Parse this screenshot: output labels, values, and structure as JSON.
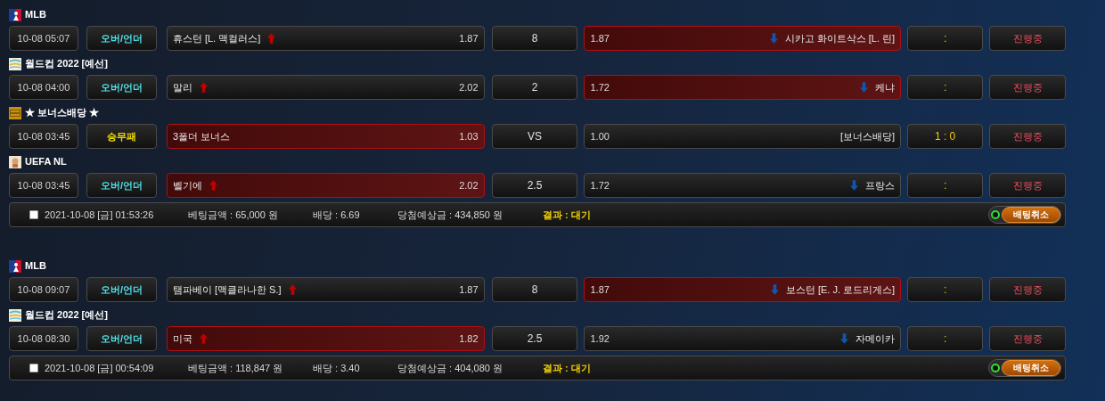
{
  "bets": [
    {
      "games": [
        {
          "league": {
            "name": "MLB",
            "kind": "mlb"
          },
          "time": "10-08 05:07",
          "market": {
            "label": "오버/언더",
            "kind": "over_under"
          },
          "home": {
            "name": "휴스턴 [L. 맥컬러스]",
            "odds": "1.87",
            "selected": false,
            "rising": true
          },
          "line": "8",
          "away": {
            "odds": "1.87",
            "name": "시카고 화이트삭스 [L. 린]",
            "selected": true,
            "falling": true
          },
          "score": ":",
          "status": "진행중"
        },
        {
          "league": {
            "name": "월드컵 2022 [예선]",
            "kind": "worldcup"
          },
          "time": "10-08 04:00",
          "market": {
            "label": "오버/언더",
            "kind": "over_under"
          },
          "home": {
            "name": "말리",
            "odds": "2.02",
            "selected": false,
            "rising": true
          },
          "line": "2",
          "away": {
            "odds": "1.72",
            "name": "케냐",
            "selected": true,
            "falling": true
          },
          "score": ":",
          "status": "진행중"
        },
        {
          "league": {
            "name": "★ 보너스배당 ★",
            "kind": "bonus"
          },
          "time": "10-08 03:45",
          "market": {
            "label": "승무패",
            "kind": "win_draw_lose"
          },
          "home": {
            "name": "3폴더 보너스",
            "odds": "1.03",
            "selected": true
          },
          "line": "VS",
          "away": {
            "odds": "1.00",
            "name": "[보너스배당]",
            "selected": false
          },
          "score": "1 : 0",
          "status": "진행중"
        },
        {
          "league": {
            "name": "UEFA NL",
            "kind": "uefa"
          },
          "time": "10-08 03:45",
          "market": {
            "label": "오버/언더",
            "kind": "over_under"
          },
          "home": {
            "name": "벨기에",
            "odds": "2.02",
            "selected": true,
            "rising": true
          },
          "line": "2.5",
          "away": {
            "odds": "1.72",
            "name": "프랑스",
            "selected": false,
            "falling": true
          },
          "score": ":",
          "status": "진행중"
        }
      ],
      "slip": {
        "checked": false,
        "date": "2021-10-08 [금] 01:53:26",
        "amount": "베팅금액 : 65,000 원",
        "odds": "배당 : 6.69",
        "payout": "당첨예상금 : 434,850 원",
        "result": "결과 : 대기",
        "cancel": "배팅취소"
      }
    },
    {
      "games": [
        {
          "league": {
            "name": "MLB",
            "kind": "mlb"
          },
          "time": "10-08 09:07",
          "market": {
            "label": "오버/언더",
            "kind": "over_under"
          },
          "home": {
            "name": "탬파베이 [맥클라나한 S.]",
            "odds": "1.87",
            "selected": false,
            "rising": true
          },
          "line": "8",
          "away": {
            "odds": "1.87",
            "name": "보스턴 [E. J. 로드리게스]",
            "selected": true,
            "falling": true
          },
          "score": ":",
          "status": "진행중"
        },
        {
          "league": {
            "name": "월드컵 2022 [예선]",
            "kind": "worldcup"
          },
          "time": "10-08 08:30",
          "market": {
            "label": "오버/언더",
            "kind": "over_under"
          },
          "home": {
            "name": "미국",
            "odds": "1.82",
            "selected": true,
            "rising": true
          },
          "line": "2.5",
          "away": {
            "odds": "1.92",
            "name": "자메이카",
            "selected": false,
            "falling": true
          },
          "score": ":",
          "status": "진행중"
        }
      ],
      "slip": {
        "checked": false,
        "date": "2021-10-08 [금] 00:54:09",
        "amount": "베팅금액 : 118,847 원",
        "odds": "배당 : 3.40",
        "payout": "당첨예상금 : 404,080 원",
        "result": "결과 : 대기",
        "cancel": "배팅취소"
      }
    }
  ]
}
